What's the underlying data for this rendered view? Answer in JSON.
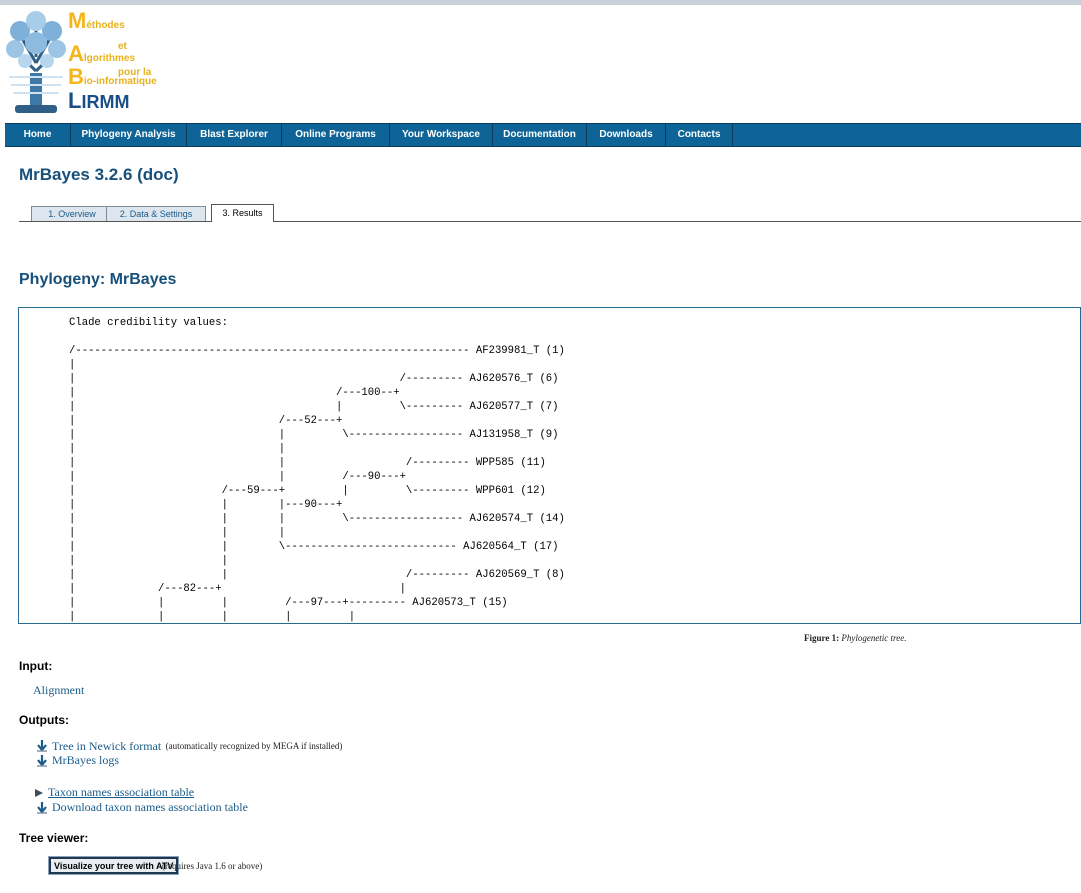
{
  "header": {
    "logo_lines": [
      {
        "cap": "M",
        "rest": "éthodes"
      },
      {
        "cap": "",
        "rest": "et"
      },
      {
        "cap": "A",
        "rest": "lgorithmes"
      },
      {
        "cap": "",
        "rest": "pour la"
      },
      {
        "cap": "B",
        "rest": "io-informatique"
      },
      {
        "cap": "L",
        "rest": "IRMM"
      }
    ]
  },
  "nav": {
    "items": [
      "Home",
      "Phylogeny Analysis",
      "Blast Explorer",
      "Online Programs",
      "Your Workspace",
      "Documentation",
      "Downloads",
      "Contacts"
    ]
  },
  "page": {
    "title": "MrBayes 3.2.6 (doc)",
    "tabs": [
      "1. Overview",
      "2. Data & Settings",
      "3. Results"
    ],
    "active_tab": "3. Results",
    "section_title": "Phylogeny: MrBayes"
  },
  "tree": {
    "text": "Clade credibility values:\n\n/-------------------------------------------------------------- AF239981_T (1)\n|\n|                                                   /--------- AJ620576_T (6)\n|                                         /---100--+\n|                                         |         \\--------- AJ620577_T (7)\n|                                /---52---+\n|                                |         \\------------------ AJ131958_T (9)\n|                                |\n|                                |                   /--------- WPP585 (11)\n|                                |         /---90---+\n|                       /---59---+         |         \\--------- WPP601 (12)\n|                       |        |---90---+\n|                       |        |         \\------------------ AJ620574_T (14)\n|                       |        |\n|                       |        \\--------------------------- AJ620564_T (17)\n|                       |\n|                       |                            /--------- AJ620569_T (8)\n|             /---82---+                            |\n|             |         |         /---97---+--------- AJ620573_T (15)\n|             |         |         |         |"
  },
  "figure": {
    "caption_label": "Figure 1:",
    "caption_text": "Phylogenetic tree."
  },
  "input": {
    "heading": "Input:",
    "alignment_link": "Alignment"
  },
  "outputs": {
    "heading": "Outputs:",
    "newick_link": "Tree in Newick format",
    "newick_note": "(automatically recognized by MEGA if installed)",
    "logs_link": "MrBayes logs",
    "taxon_table_link": "Taxon names association table",
    "download_taxon_link": "Download taxon names association table"
  },
  "tree_viewer": {
    "heading": "Tree viewer:",
    "button_label": "Visualize your tree with ATV",
    "note": "(requires Java 1.6 or above)"
  },
  "colors": {
    "nav_bg": "#0e6496",
    "title": "#17507a",
    "link": "#1a5c8a"
  }
}
